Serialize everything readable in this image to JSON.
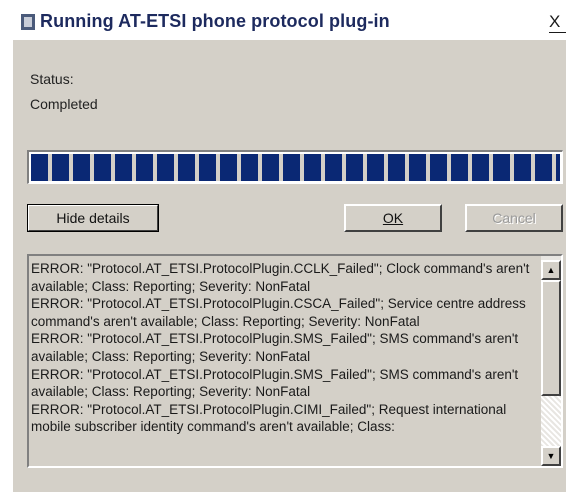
{
  "window": {
    "title": "Running AT-ETSI phone protocol plug-in",
    "close_label": "X"
  },
  "status": {
    "label": "Status:",
    "value": "Completed"
  },
  "progress": {
    "fraction": 1.0
  },
  "buttons": {
    "hide_details": "Hide details",
    "ok": "OK",
    "cancel": "Cancel"
  },
  "details": {
    "lines": [
      "ERROR: \"Protocol.AT_ETSI.ProtocolPlugin.CCLK_Failed\"; Clock command's aren't available; Class: Reporting; Severity: NonFatal",
      "ERROR: \"Protocol.AT_ETSI.ProtocolPlugin.CSCA_Failed\"; Service centre address command's aren't available; Class: Reporting; Severity: NonFatal",
      "ERROR: \"Protocol.AT_ETSI.ProtocolPlugin.SMS_Failed\"; SMS command's aren't available; Class: Reporting; Severity: NonFatal",
      "ERROR: \"Protocol.AT_ETSI.ProtocolPlugin.SMS_Failed\"; SMS command's aren't available; Class: Reporting; Severity: NonFatal",
      "ERROR: \"Protocol.AT_ETSI.ProtocolPlugin.CIMI_Failed\"; Request international mobile subscriber identity command's aren't available; Class:"
    ]
  },
  "icons": {
    "app": "window-app-icon",
    "scroll_up": "scroll-up-arrow-icon",
    "scroll_down": "scroll-down-arrow-icon"
  }
}
